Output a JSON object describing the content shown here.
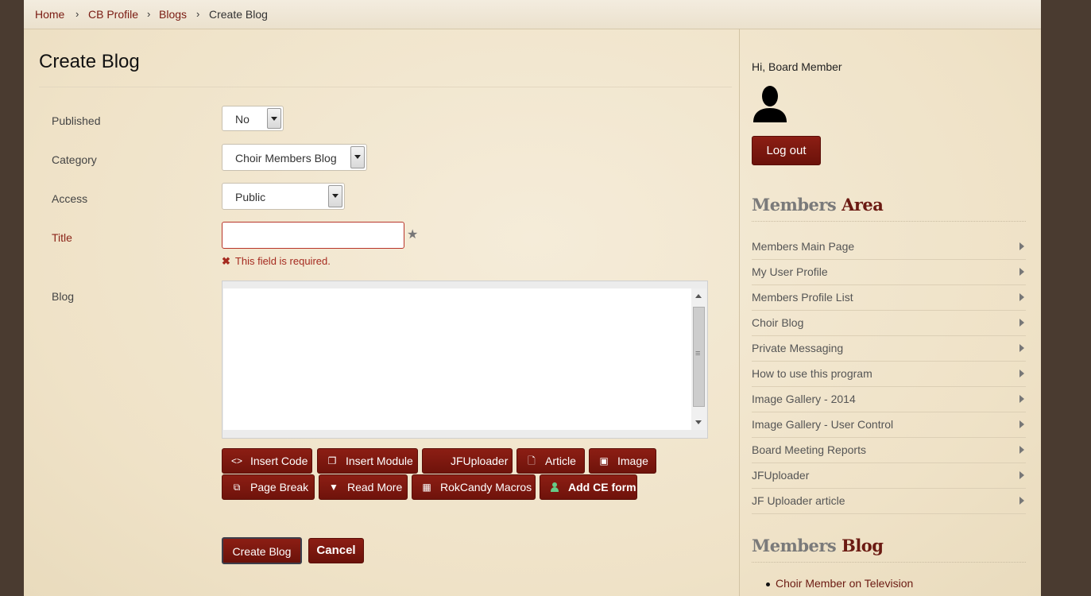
{
  "breadcrumb": {
    "items": [
      "Home",
      "CB Profile",
      "Blogs"
    ],
    "current": "Create Blog",
    "separator": "›"
  },
  "form": {
    "title": "Create Blog",
    "fields": {
      "published": {
        "label": "Published",
        "value": "No"
      },
      "category": {
        "label": "Category",
        "value": "Choir Members Blog"
      },
      "access": {
        "label": "Access",
        "value": "Public"
      },
      "title": {
        "label": "Title",
        "value": "",
        "error": "This field is required."
      },
      "blog": {
        "label": "Blog"
      }
    },
    "editor_buttons": [
      {
        "label": "Insert Code",
        "icon": "code-icon"
      },
      {
        "label": "Insert Module",
        "icon": "module-icon"
      },
      {
        "label": "JFUploader",
        "icon": ""
      },
      {
        "label": "Article",
        "icon": "article-icon"
      },
      {
        "label": "Image",
        "icon": "image-icon"
      },
      {
        "label": "Page Break",
        "icon": "page-break-icon"
      },
      {
        "label": "Read More",
        "icon": "chevron-down-icon"
      },
      {
        "label": "RokCandy Macros",
        "icon": "macros-icon"
      },
      {
        "label": "Add CE form",
        "icon": "person-icon"
      }
    ],
    "submit_label": "Create Blog",
    "cancel_label": "Cancel"
  },
  "sidebar": {
    "greeting": "Hi, Board Member",
    "logout_label": "Log out",
    "members_area": {
      "title_part1": "Members",
      "title_part2": "Area",
      "items": [
        "Members Main Page",
        "My User Profile",
        "Members Profile List",
        "Choir Blog",
        "Private Messaging",
        "How to use this program",
        "Image Gallery - 2014",
        "Image Gallery - User Control",
        "Board Meeting Reports",
        "JFUploader",
        "JF Uploader article"
      ]
    },
    "members_blog": {
      "title_part1": "Members",
      "title_part2": "Blog",
      "items": [
        "Choir Member on Television"
      ]
    }
  },
  "colors": {
    "accent": "#7a1b12",
    "background": "#f1e6cf",
    "frame": "#4a3b30",
    "error": "#a52a1f"
  }
}
